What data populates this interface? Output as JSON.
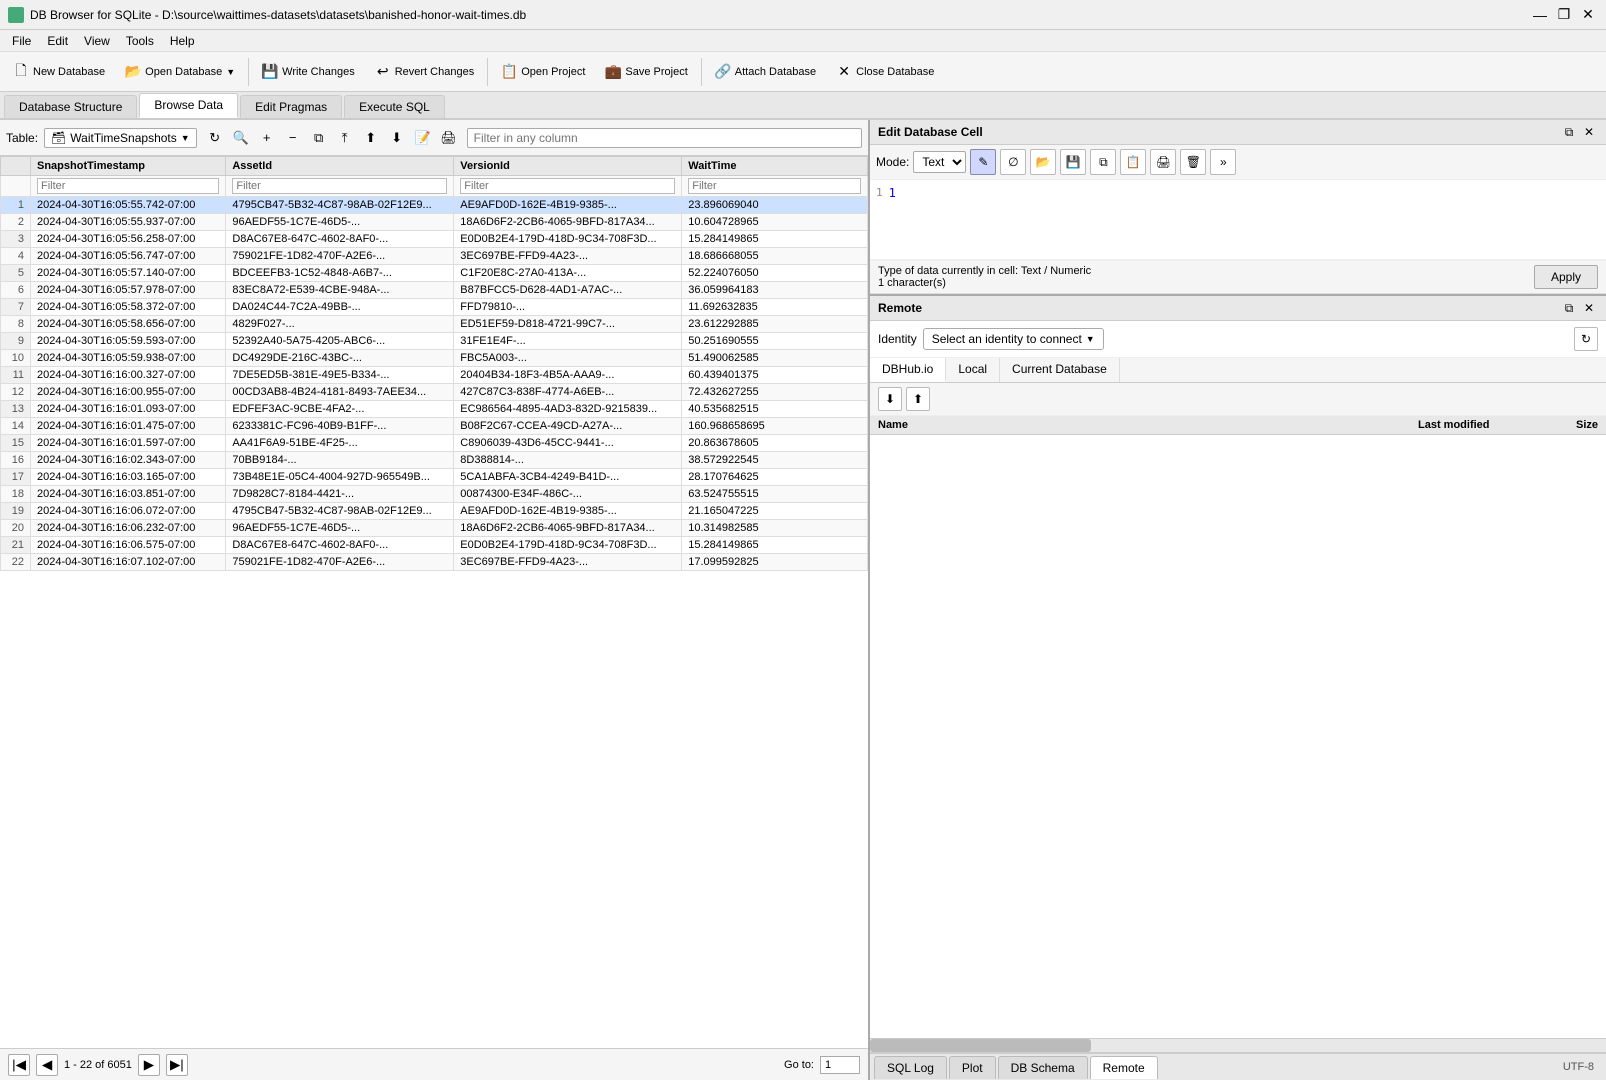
{
  "app": {
    "title": "DB Browser for SQLite - D:\\source\\waittimes-datasets\\datasets\\banished-honor-wait-times.db",
    "icon": "database-icon"
  },
  "menu": {
    "items": [
      "File",
      "Edit",
      "View",
      "Tools",
      "Help"
    ]
  },
  "toolbar": {
    "buttons": [
      {
        "label": "New Database",
        "icon": "new-db-icon"
      },
      {
        "label": "Open Database",
        "icon": "open-db-icon"
      },
      {
        "label": "Write Changes",
        "icon": "write-icon"
      },
      {
        "label": "Revert Changes",
        "icon": "revert-icon"
      },
      {
        "label": "Open Project",
        "icon": "project-icon"
      },
      {
        "label": "Save Project",
        "icon": "save-project-icon"
      },
      {
        "label": "Attach Database",
        "icon": "attach-icon"
      },
      {
        "label": "Close Database",
        "icon": "close-db-icon"
      }
    ]
  },
  "tabs": {
    "items": [
      "Database Structure",
      "Browse Data",
      "Edit Pragmas",
      "Execute SQL"
    ],
    "active": "Browse Data"
  },
  "table_bar": {
    "label": "Table:",
    "table_name": "WaitTimeSnapshots",
    "filter_placeholder": "Filter in any column"
  },
  "columns": [
    "SnapshotTimestamp",
    "AssetId",
    "VersionId",
    "WaitTime"
  ],
  "rows": [
    {
      "num": 1,
      "ts": "2024-04-30T16:05:55.742-07:00",
      "asset": "4795CB47-5B32-4C87-98AB-02F12E9...",
      "version": "AE9AFD0D-162E-4B19-9385-...",
      "wait": "23.896069040"
    },
    {
      "num": 2,
      "ts": "2024-04-30T16:05:55.937-07:00",
      "asset": "96AEDF55-1C7E-46D5-...",
      "version": "18A6D6F2-2CB6-4065-9BFD-817A34...",
      "wait": "10.604728965"
    },
    {
      "num": 3,
      "ts": "2024-04-30T16:05:56.258-07:00",
      "asset": "D8AC67E8-647C-4602-8AF0-...",
      "version": "E0D0B2E4-179D-418D-9C34-708F3D...",
      "wait": "15.284149865"
    },
    {
      "num": 4,
      "ts": "2024-04-30T16:05:56.747-07:00",
      "asset": "759021FE-1D82-470F-A2E6-...",
      "version": "3EC697BE-FFD9-4A23-...",
      "wait": "18.686668055"
    },
    {
      "num": 5,
      "ts": "2024-04-30T16:05:57.140-07:00",
      "asset": "BDCEEFB3-1C52-4848-A6B7-...",
      "version": "C1F20E8C-27A0-413A-...",
      "wait": "52.224076050"
    },
    {
      "num": 6,
      "ts": "2024-04-30T16:05:57.978-07:00",
      "asset": "83EC8A72-E539-4CBE-948A-...",
      "version": "B87BFCC5-D628-4AD1-A7AC-...",
      "wait": "36.059964183"
    },
    {
      "num": 7,
      "ts": "2024-04-30T16:05:58.372-07:00",
      "asset": "DA024C44-7C2A-49BB-...",
      "version": "FFD79810-...",
      "wait": "11.692632835"
    },
    {
      "num": 8,
      "ts": "2024-04-30T16:05:58.656-07:00",
      "asset": "4829F027-...",
      "version": "ED51EF59-D818-4721-99C7-...",
      "wait": "23.612292885"
    },
    {
      "num": 9,
      "ts": "2024-04-30T16:05:59.593-07:00",
      "asset": "52392A40-5A75-4205-ABC6-...",
      "version": "31FE1E4F-...",
      "wait": "50.251690555"
    },
    {
      "num": 10,
      "ts": "2024-04-30T16:05:59.938-07:00",
      "asset": "DC4929DE-216C-43BC-...",
      "version": "FBC5A003-...",
      "wait": "51.490062585"
    },
    {
      "num": 11,
      "ts": "2024-04-30T16:16:00.327-07:00",
      "asset": "7DE5ED5B-381E-49E5-B334-...",
      "version": "20404B34-18F3-4B5A-AAA9-...",
      "wait": "60.439401375"
    },
    {
      "num": 12,
      "ts": "2024-04-30T16:16:00.955-07:00",
      "asset": "00CD3AB8-4B24-4181-8493-7AEE34...",
      "version": "427C87C3-838F-4774-A6EB-...",
      "wait": "72.432627255"
    },
    {
      "num": 13,
      "ts": "2024-04-30T16:16:01.093-07:00",
      "asset": "EDFEF3AC-9CBE-4FA2-...",
      "version": "EC986564-4895-4AD3-832D-9215839...",
      "wait": "40.535682515"
    },
    {
      "num": 14,
      "ts": "2024-04-30T16:16:01.475-07:00",
      "asset": "6233381C-FC96-40B9-B1FF-...",
      "version": "B08F2C67-CCEA-49CD-A27A-...",
      "wait": "160.968658695"
    },
    {
      "num": 15,
      "ts": "2024-04-30T16:16:01.597-07:00",
      "asset": "AA41F6A9-51BE-4F25-...",
      "version": "C8906039-43D6-45CC-9441-...",
      "wait": "20.863678605"
    },
    {
      "num": 16,
      "ts": "2024-04-30T16:16:02.343-07:00",
      "asset": "70BB9184-...",
      "version": "8D388814-...",
      "wait": "38.572922545"
    },
    {
      "num": 17,
      "ts": "2024-04-30T16:16:03.165-07:00",
      "asset": "73B48E1E-05C4-4004-927D-965549B...",
      "version": "5CA1ABFA-3CB4-4249-B41D-...",
      "wait": "28.170764625"
    },
    {
      "num": 18,
      "ts": "2024-04-30T16:16:03.851-07:00",
      "asset": "7D9828C7-8184-4421-...",
      "version": "00874300-E34F-486C-...",
      "wait": "63.524755515"
    },
    {
      "num": 19,
      "ts": "2024-04-30T16:16:06.072-07:00",
      "asset": "4795CB47-5B32-4C87-98AB-02F12E9...",
      "version": "AE9AFD0D-162E-4B19-9385-...",
      "wait": "21.165047225"
    },
    {
      "num": 20,
      "ts": "2024-04-30T16:16:06.232-07:00",
      "asset": "96AEDF55-1C7E-46D5-...",
      "version": "18A6D6F2-2CB6-4065-9BFD-817A34...",
      "wait": "10.314982585"
    },
    {
      "num": 21,
      "ts": "2024-04-30T16:16:06.575-07:00",
      "asset": "D8AC67E8-647C-4602-8AF0-...",
      "version": "E0D0B2E4-179D-418D-9C34-708F3D...",
      "wait": "15.284149865"
    },
    {
      "num": 22,
      "ts": "2024-04-30T16:16:07.102-07:00",
      "asset": "759021FE-1D82-470F-A2E6-...",
      "version": "3EC697BE-FFD9-4A23-...",
      "wait": "17.099592825"
    }
  ],
  "selected_row": 1,
  "pagination": {
    "info": "1 - 22 of 6051",
    "goto_label": "Go to:",
    "goto_value": "1"
  },
  "edit_cell": {
    "panel_title": "Edit Database Cell",
    "mode_label": "Mode:",
    "mode_value": "Text",
    "cell_value": "1",
    "line_number": "1",
    "type_info": "Type of data currently in cell: Text / Numeric",
    "char_info": "1 character(s)",
    "apply_label": "Apply"
  },
  "remote": {
    "panel_title": "Remote",
    "identity_label": "Identity",
    "identity_placeholder": "Select an identity to connect",
    "tabs": [
      "DBHub.io",
      "Local",
      "Current Database"
    ],
    "active_tab": "DBHub.io",
    "file_columns": [
      "Name",
      "Last modified",
      "Size"
    ]
  },
  "bottom_tabs": {
    "items": [
      "SQL Log",
      "Plot",
      "DB Schema",
      "Remote"
    ],
    "active": "Remote",
    "status": "UTF-8"
  }
}
